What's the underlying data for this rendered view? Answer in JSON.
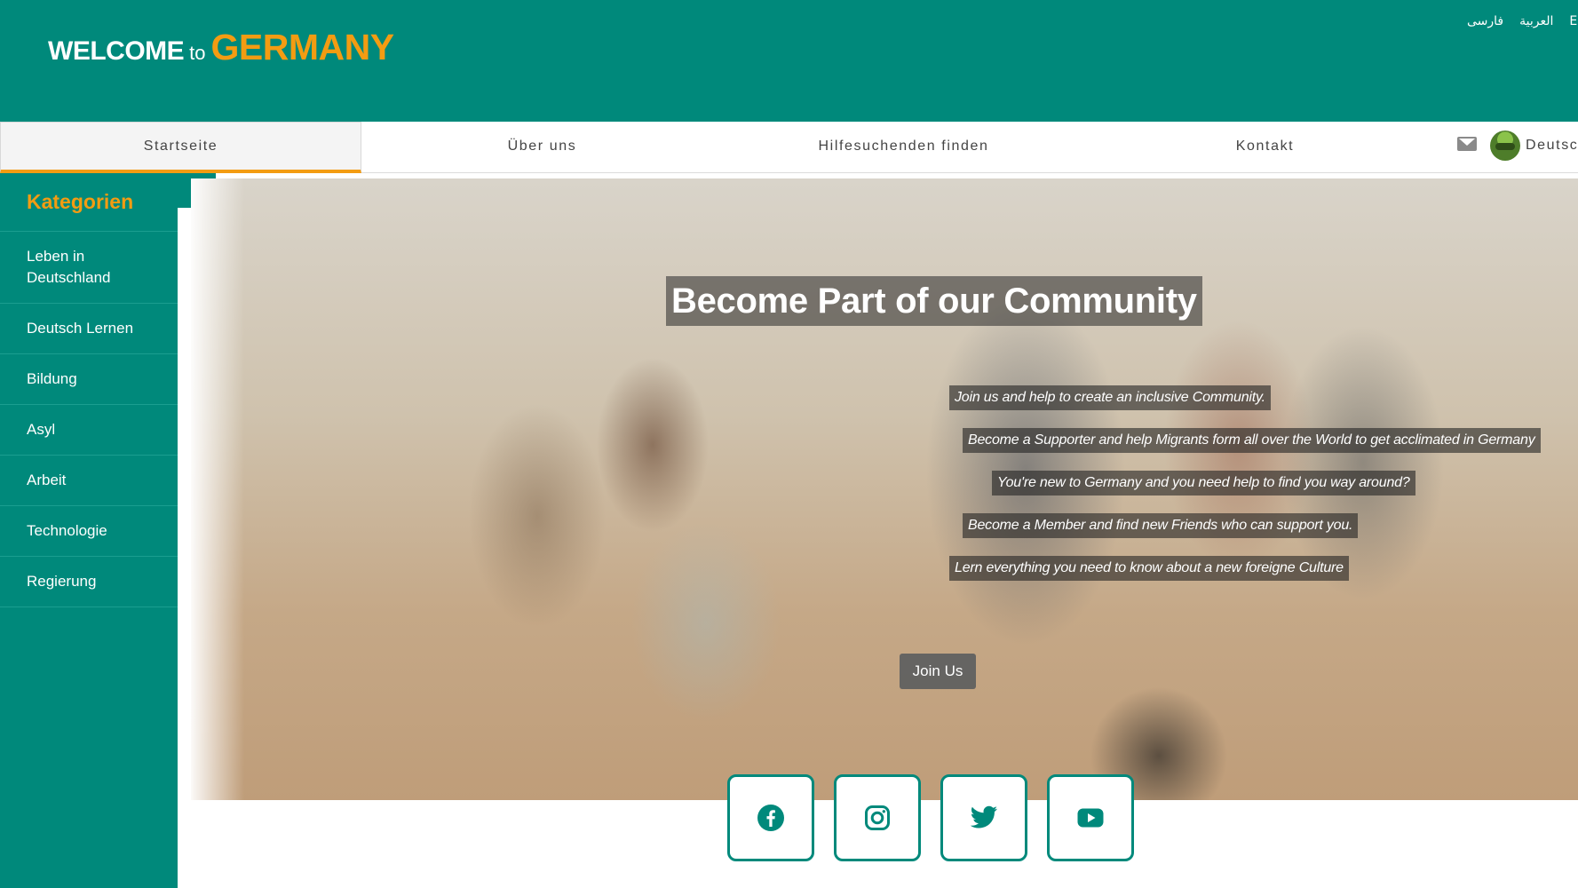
{
  "header": {
    "logo": {
      "welcome": "WELCOME",
      "to": "to",
      "country": "GERMANY"
    },
    "languages": [
      "فارسی",
      "العربية",
      "En"
    ]
  },
  "nav": {
    "items": [
      "Startseite",
      "Über uns",
      "Hilfesuchenden finden",
      "Kontakt"
    ],
    "active": "Startseite",
    "language_label": "Deutsc",
    "icons": [
      "mail-icon",
      "avatar"
    ]
  },
  "sidebar": {
    "title": "Kategorien",
    "items": [
      "Leben in Deutschland",
      "Deutsch Lernen",
      "Bildung",
      "Asyl",
      "Arbeit",
      "Technologie",
      "Regierung"
    ],
    "toggle_icon": "chevron-left-icon"
  },
  "hero": {
    "title": "Become Part of our Community",
    "lines": [
      "Join us and help to create an inclusive Community.",
      "Become a Supporter and help Migrants form all over the World to get acclimated in Germany",
      "You're new to Germany and you need help to find you way around?",
      "Become a Member and find new Friends who can support you.",
      "Lern everything you need to know about a new foreigne Culture"
    ],
    "button": "Join Us"
  },
  "social": {
    "icons": [
      "facebook-icon",
      "instagram-icon",
      "twitter-icon",
      "youtube-icon"
    ]
  },
  "colors": {
    "primary": "#00897b",
    "accent": "#f39c12",
    "white": "#ffffff"
  }
}
